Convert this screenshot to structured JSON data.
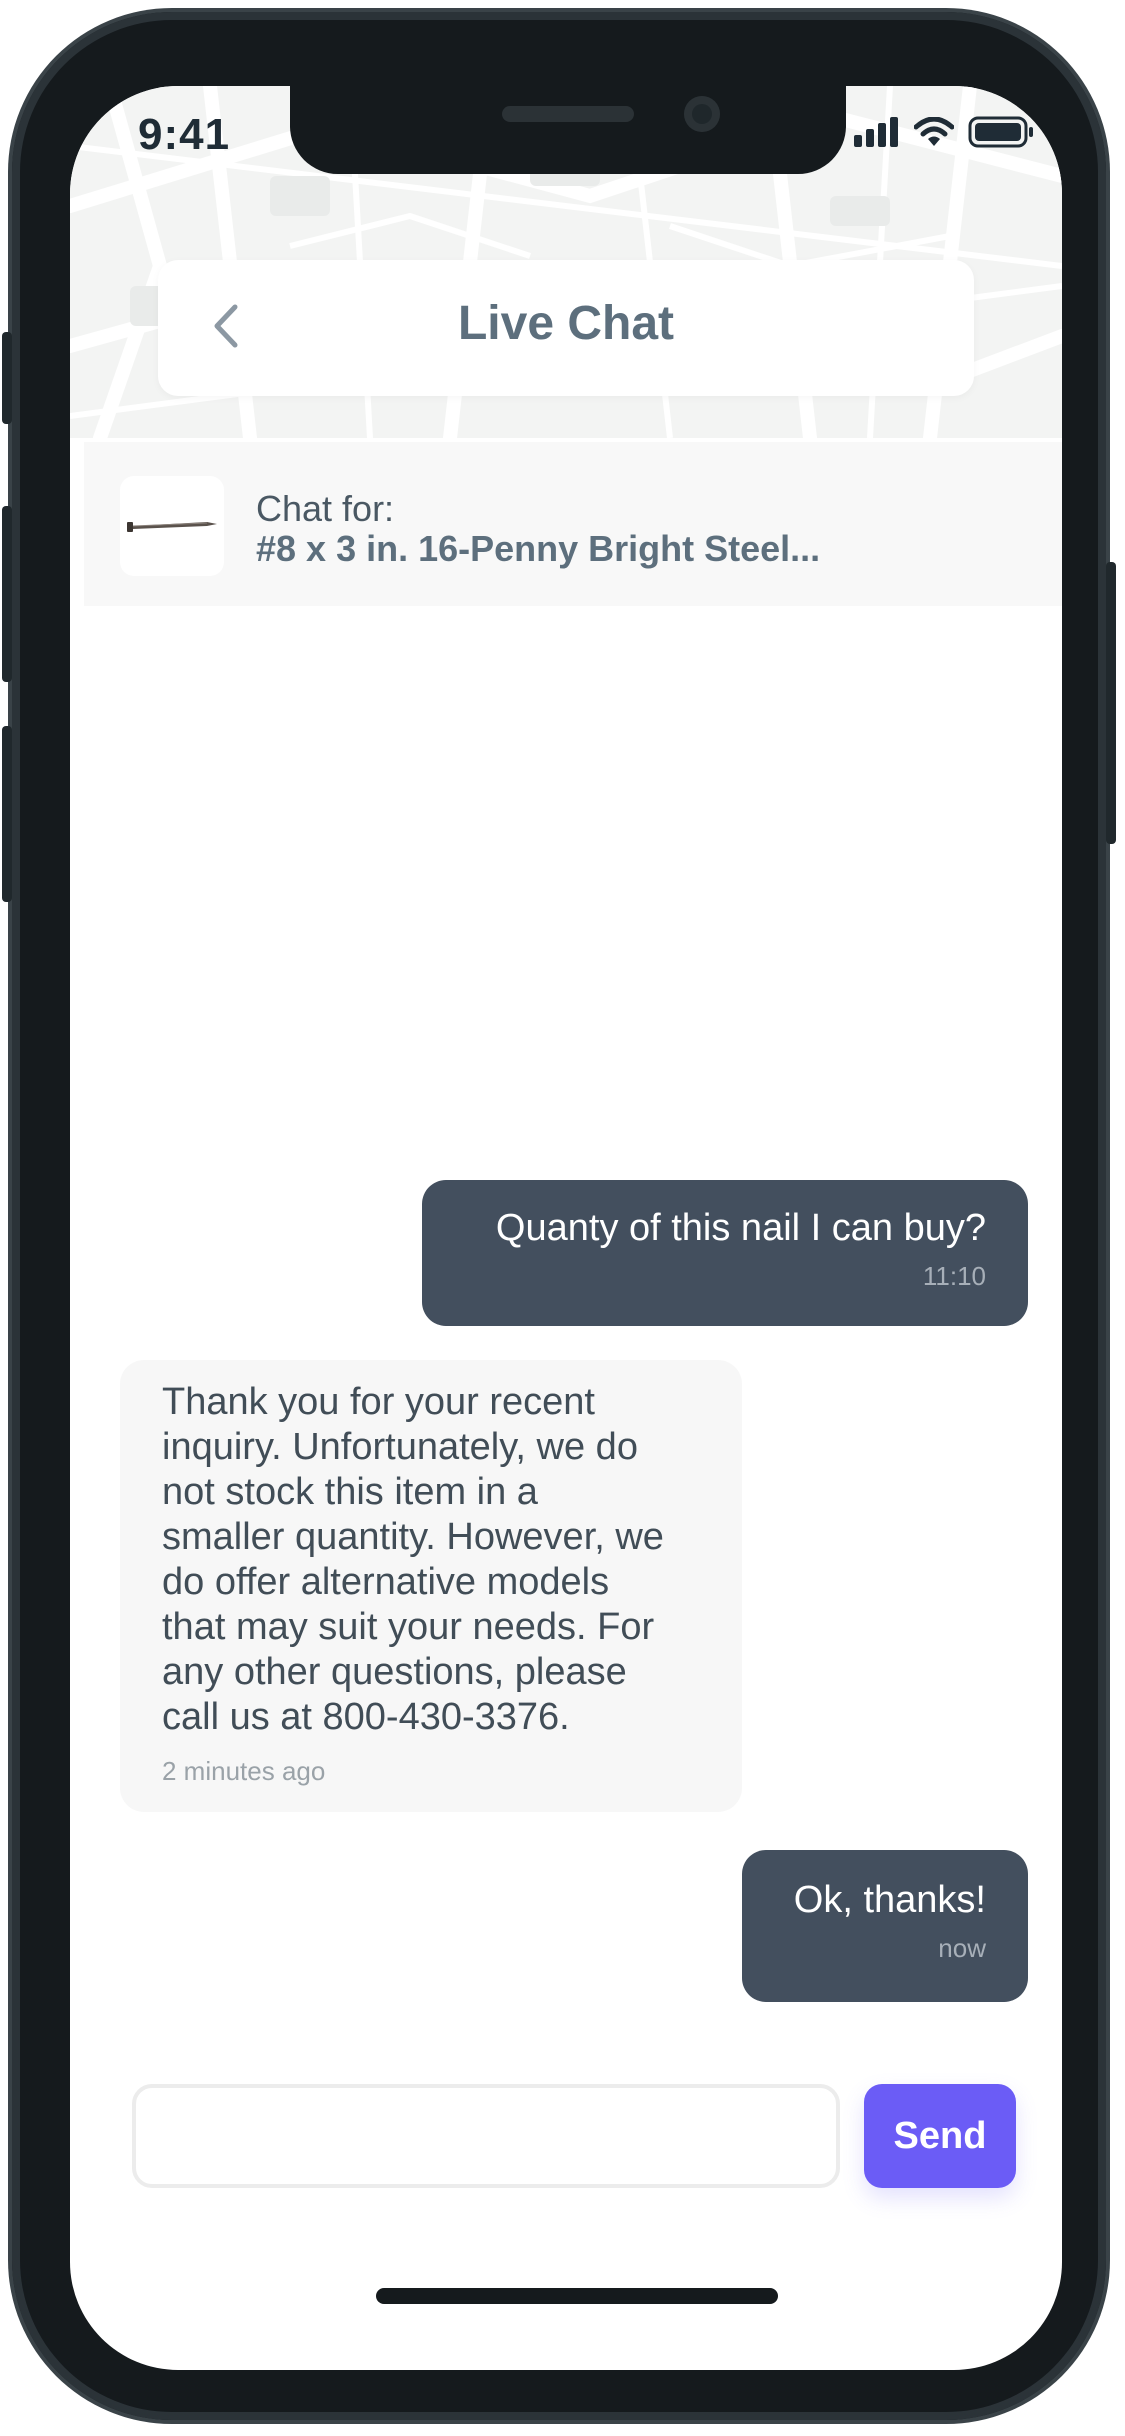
{
  "status_bar": {
    "time": "9:41",
    "icons": [
      "cellular-signal-icon",
      "wifi-icon",
      "battery-icon"
    ]
  },
  "header": {
    "title": "Live Chat",
    "back_icon": "chevron-left-icon"
  },
  "product": {
    "label": "Chat for:",
    "name": "#8 x 3 in. 16-Penny Bright Steel...",
    "thumbnail": "nail-image"
  },
  "messages": [
    {
      "direction": "outgoing",
      "text": "Quanty of this nail I can buy?",
      "time": "11:10"
    },
    {
      "direction": "incoming",
      "lines": [
        "Thank you for your recent",
        "inquiry. Unfortunately, we do",
        "not stock this item in a",
        "smaller quantity. However, we",
        "do offer alternative models",
        "that may suit your needs. For",
        "any other questions, please",
        "call us at 800-430-3376."
      ],
      "time": "2 minutes ago"
    },
    {
      "direction": "outgoing",
      "text": "Ok, thanks!",
      "time": "now"
    }
  ],
  "composer": {
    "input_value": "",
    "placeholder": "",
    "send_label": "Send"
  },
  "colors": {
    "accent": "#6b5cf6",
    "outgoing_bubble": "#434f5e",
    "incoming_bubble": "#f7f7f7",
    "title_text": "#5d6f7d"
  }
}
